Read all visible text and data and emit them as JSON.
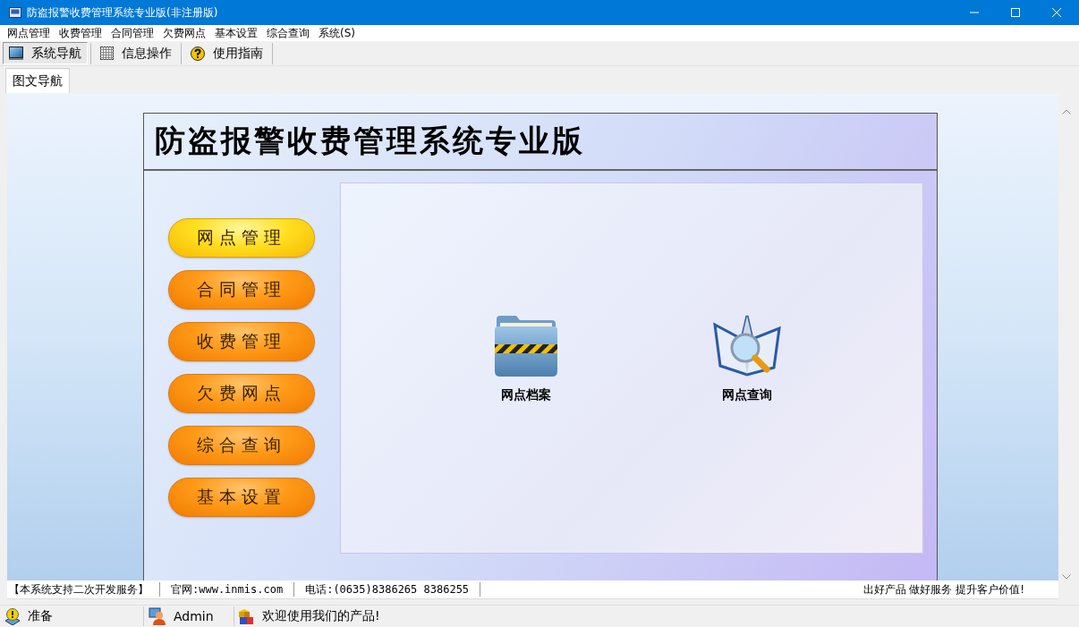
{
  "window": {
    "title": "防盗报警收费管理系统专业版(非注册版)"
  },
  "menu": [
    "网点管理",
    "收费管理",
    "合同管理",
    "欠费网点",
    "基本设置",
    "综合查询",
    "系统(S)"
  ],
  "toolbar": [
    {
      "label": "系统导航",
      "kind": "monitor",
      "selected": true
    },
    {
      "label": "信息操作",
      "kind": "grid",
      "selected": false
    },
    {
      "label": "使用指南",
      "kind": "help",
      "selected": false
    }
  ],
  "tabs": [
    {
      "label": "图文导航",
      "selected": true
    }
  ],
  "panel": {
    "title": "防盗报警收费管理系统专业版",
    "nav_buttons": [
      {
        "label": "网点管理",
        "selected": true
      },
      {
        "label": "合同管理",
        "selected": false
      },
      {
        "label": "收费管理",
        "selected": false
      },
      {
        "label": "欠费网点",
        "selected": false
      },
      {
        "label": "综合查询",
        "selected": false
      },
      {
        "label": "基本设置",
        "selected": false
      }
    ],
    "shortcuts": [
      {
        "label": "网点档案",
        "kind": "folder"
      },
      {
        "label": "网点查询",
        "kind": "search"
      }
    ]
  },
  "footer": {
    "cells": [
      "【本系统支持二次开发服务】",
      "官网:www.inmis.com",
      "电话:(0635)8386265 8386255"
    ],
    "slogan": "出好产品 做好服务 提升客户价值!"
  },
  "status_bar": [
    {
      "kind": "info",
      "text": "准备"
    },
    {
      "kind": "user",
      "text": "Admin"
    },
    {
      "kind": "cubes",
      "text": "欢迎使用我们的产品!"
    }
  ]
}
